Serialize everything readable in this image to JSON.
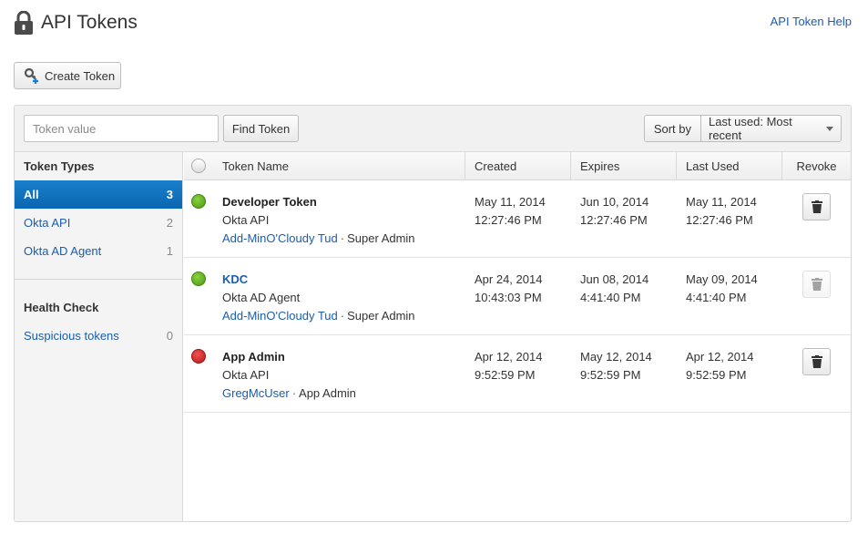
{
  "header": {
    "title": "API Tokens",
    "help_link": "API Token Help"
  },
  "actions": {
    "create_token": "Create Token"
  },
  "search": {
    "placeholder": "Token value",
    "find_button": "Find Token"
  },
  "sort": {
    "label": "Sort by",
    "selected": "Last used: Most recent"
  },
  "sidebar": {
    "token_types_heading": "Token Types",
    "token_types": [
      {
        "label": "All",
        "count": "3"
      },
      {
        "label": "Okta API",
        "count": "2"
      },
      {
        "label": "Okta AD Agent",
        "count": "1"
      }
    ],
    "health_heading": "Health Check",
    "health_items": [
      {
        "label": "Suspicious tokens",
        "count": "0"
      }
    ]
  },
  "table": {
    "columns": {
      "name": "Token Name",
      "created": "Created",
      "expires": "Expires",
      "last_used": "Last Used",
      "revoke": "Revoke"
    },
    "rows": [
      {
        "status": "green",
        "name": "Developer Token",
        "type": "Okta API",
        "creator": "Add-MinO'Cloudy Tud",
        "role": "Super Admin",
        "created_date": "May 11, 2014",
        "created_time": "12:27:46 PM",
        "expires_date": "Jun 10, 2014",
        "expires_time": "12:27:46 PM",
        "last_date": "May 11, 2014",
        "last_time": "12:27:46 PM"
      },
      {
        "status": "green",
        "name": "KDC",
        "type": "Okta AD Agent",
        "creator": "Add-MinO'Cloudy Tud",
        "role": "Super Admin",
        "created_date": "Apr 24, 2014",
        "created_time": "10:43:03 PM",
        "expires_date": "Jun 08, 2014",
        "expires_time": "4:41:40 PM",
        "last_date": "May 09, 2014",
        "last_time": "4:41:40 PM"
      },
      {
        "status": "red",
        "name": "App Admin",
        "type": "Okta API",
        "creator": "GregMcUser",
        "role": "App Admin",
        "created_date": "Apr 12, 2014",
        "created_time": "9:52:59 PM",
        "expires_date": "May 12, 2014",
        "expires_time": "9:52:59 PM",
        "last_date": "Apr 12, 2014",
        "last_time": "9:52:59 PM"
      }
    ]
  },
  "separator": "·",
  "colors": {
    "link": "#1a5db0",
    "active": "#0a66b0",
    "status_ok": "#5aa81a",
    "status_bad": "#c62020"
  },
  "icons": {
    "title": "lock-icon",
    "create": "key-add-icon",
    "revoke": "trash-icon"
  }
}
